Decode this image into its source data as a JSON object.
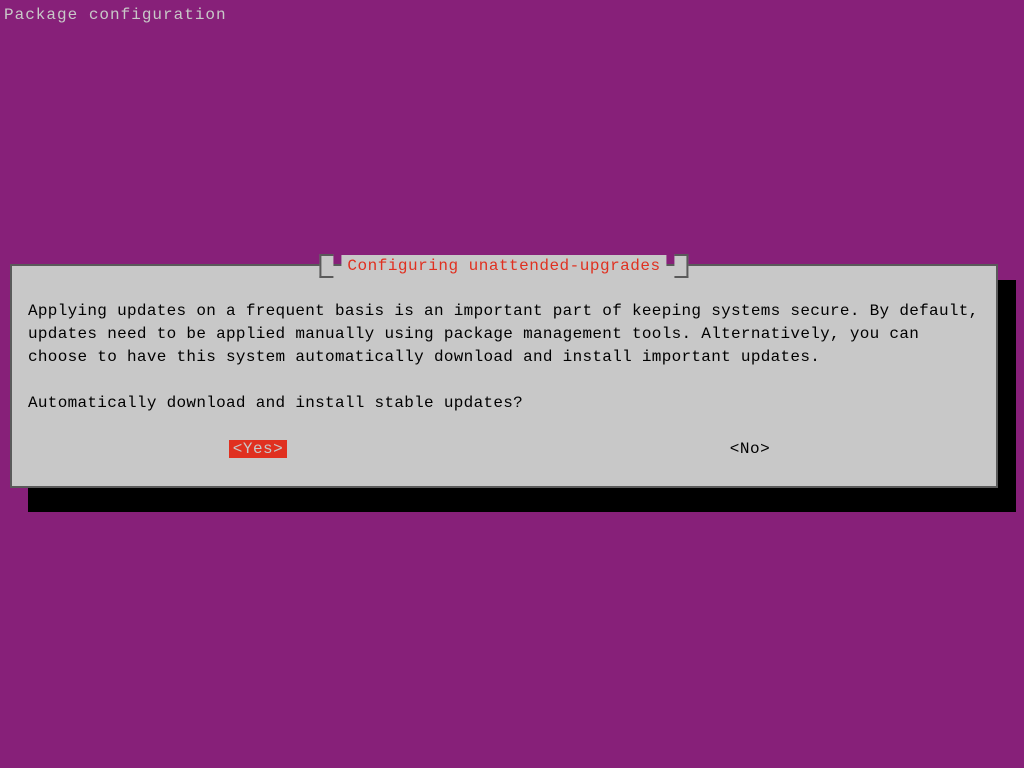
{
  "header": {
    "label": "Package configuration"
  },
  "dialog": {
    "title": "Configuring unattended-upgrades",
    "body_paragraph": "Applying updates on a frequent basis is an important part of keeping systems secure. By default, updates need to be applied manually using package management tools. Alternatively, you can choose to have this system automatically download and install important updates.",
    "question": "Automatically download and install stable updates?",
    "buttons": {
      "yes": "<Yes>",
      "no": "<No>"
    },
    "selected": "yes"
  },
  "colors": {
    "background": "#872079",
    "dialog_bg": "#c8c8c8",
    "dialog_border": "#5a5a5a",
    "accent": "#e03020",
    "shadow": "#000000",
    "text_light": "#c8c8c8",
    "text_dark": "#000000"
  }
}
